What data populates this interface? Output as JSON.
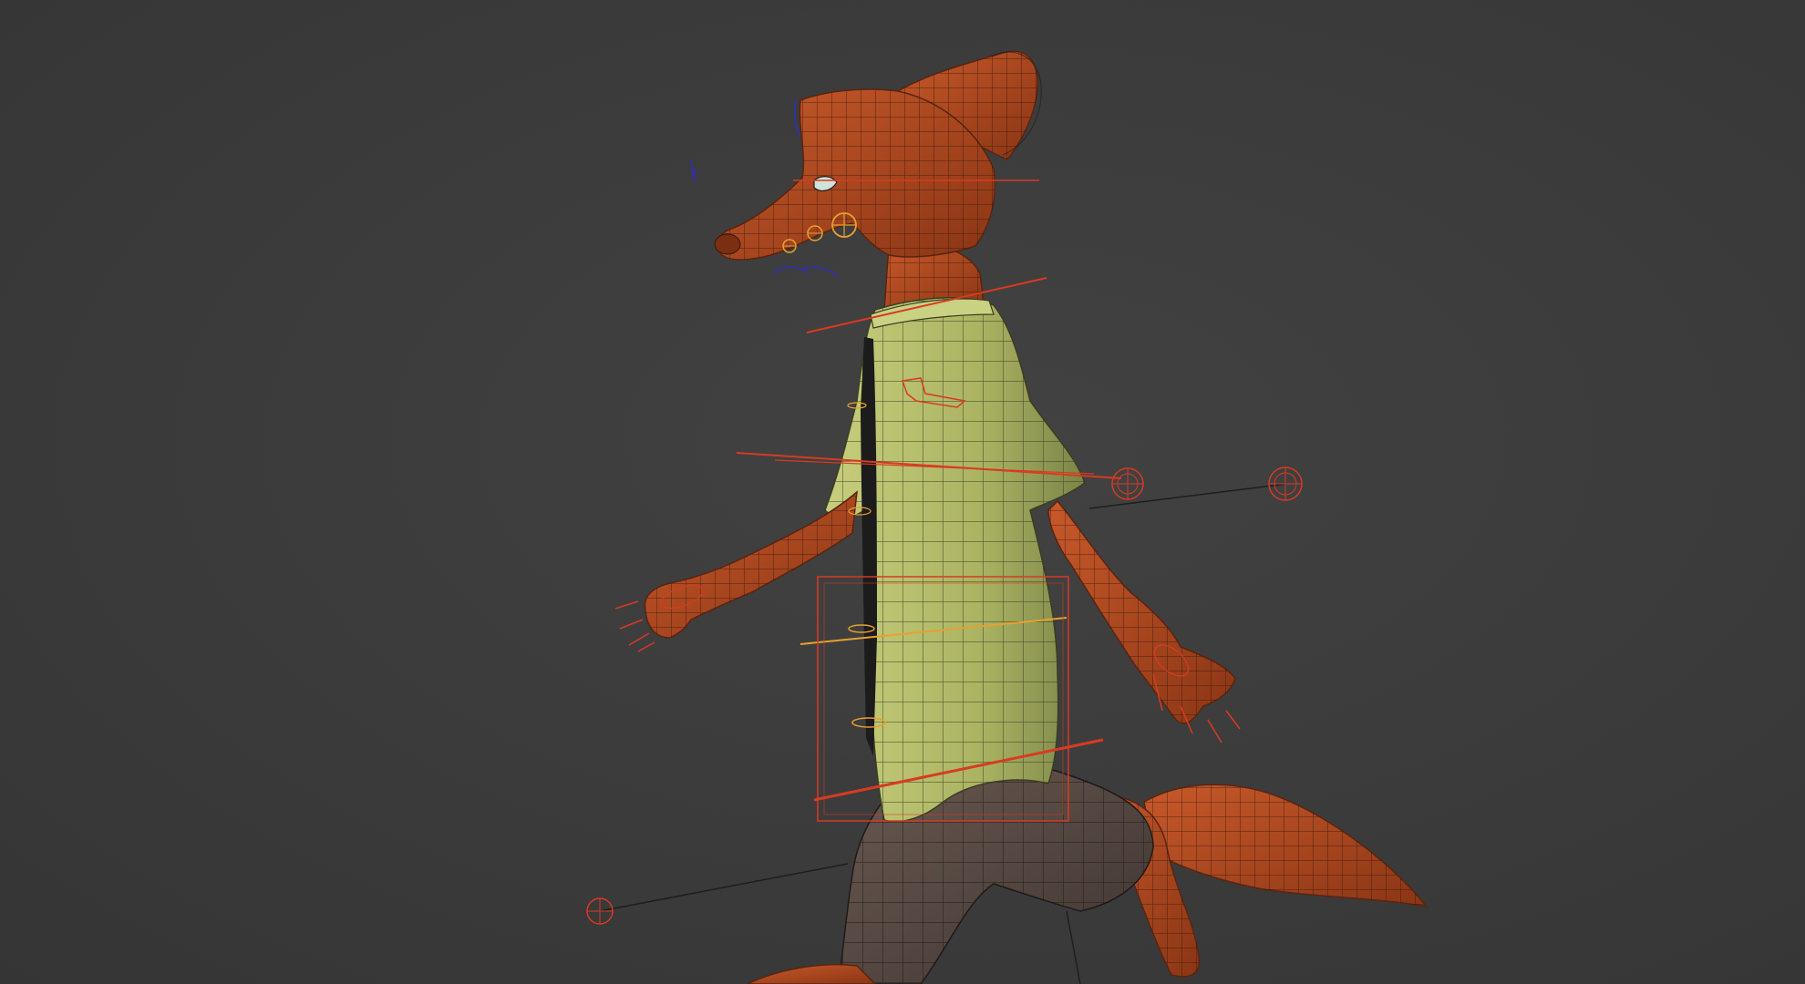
{
  "viewport": {
    "background": "#3b3b3b",
    "shaded_wireframe": true
  },
  "character": {
    "fur_color": "#b24a1c",
    "fur_shadow": "#7a2e12",
    "shirt_color": "#b8c06e",
    "shirt_shadow": "#6f7540",
    "pants_color": "#5a4a44",
    "tie_color": "#1c1c1c",
    "wire_color": "#2a1510"
  },
  "rig": {
    "control_color": "#d83a22",
    "control_orange": "#e8a030",
    "control_blue": "#2f2fb8",
    "line_color": "#1e1e1e"
  }
}
